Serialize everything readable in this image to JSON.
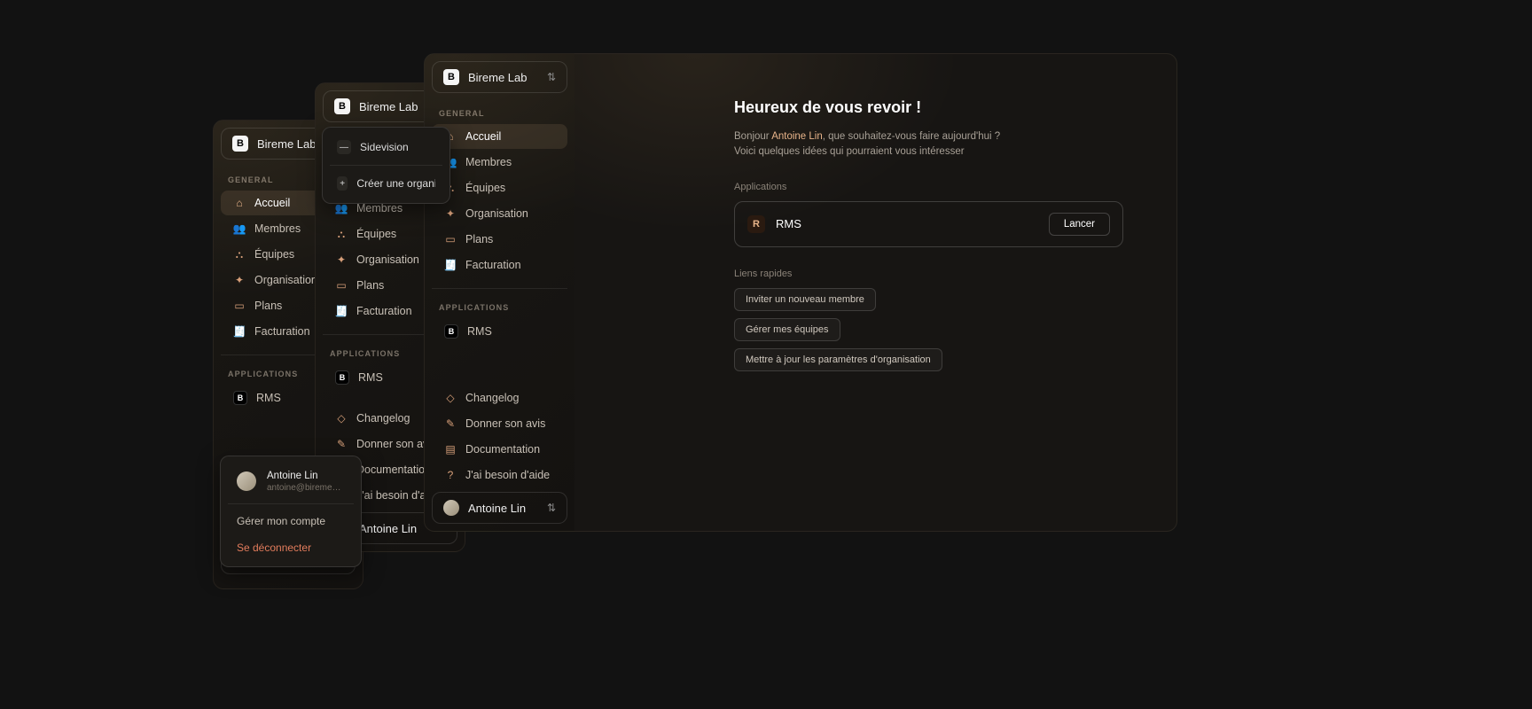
{
  "org": {
    "name": "Bireme Lab",
    "initial": "B"
  },
  "org_popover": {
    "current": "Sidevision",
    "create_label": "Créer une organisa…"
  },
  "sections": {
    "general": "GENERAL",
    "applications": "APPLICATIONS"
  },
  "nav": {
    "accueil": "Accueil",
    "membres": "Membres",
    "equipes": "Équipes",
    "organisation": "Organisation",
    "plans": "Plans",
    "facturation": "Facturation"
  },
  "apps": {
    "rms": {
      "label": "RMS",
      "initial": "R",
      "icon": "B"
    }
  },
  "footer_nav": {
    "changelog": "Changelog",
    "feedback": "Donner son avis",
    "documentation": "Documentation",
    "help": "J'ai besoin d'aide"
  },
  "user": {
    "name": "Antoine Lin",
    "email": "antoine@bireme…",
    "manage": "Gérer mon compte",
    "logout": "Se déconnecter"
  },
  "main": {
    "title": "Heureux de vous revoir !",
    "greet_pre": "Bonjour ",
    "greet_name": "Antoine Lin",
    "greet_post": ", que souhaitez-vous faire aujourd'hui ?",
    "greet_sub": "Voici quelques idées qui pourraient vous intéresser",
    "apps_label": "Applications",
    "launch": "Lancer",
    "quick_label": "Liens rapides",
    "ql1": "Inviter un nouveau membre",
    "ql2": "Gérer mes équipes",
    "ql3": "Mettre à jour les paramètres d'organisation"
  }
}
